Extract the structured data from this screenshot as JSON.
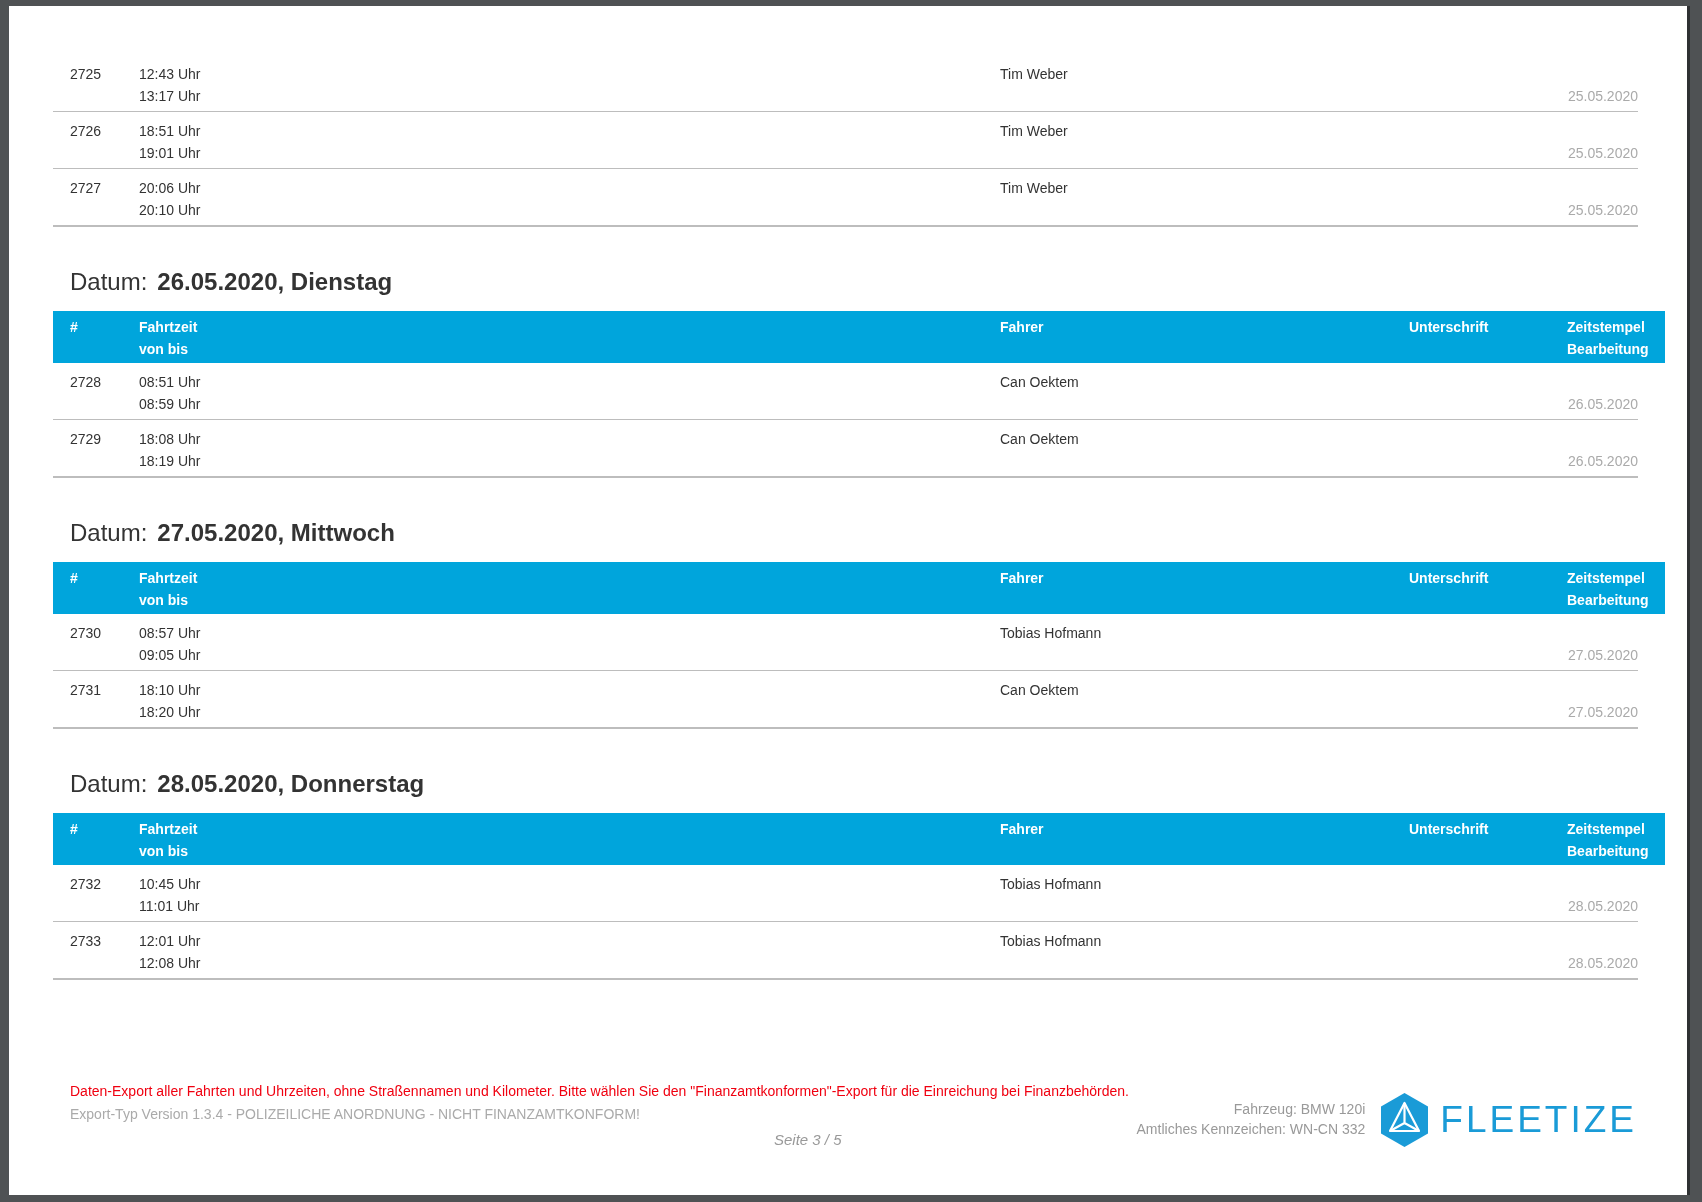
{
  "continued_table": {
    "rows": [
      {
        "number": "2725",
        "start": "12:43 Uhr",
        "end": "13:17 Uhr",
        "driver": "Tim Weber",
        "timestamp": "25.05.2020"
      },
      {
        "number": "2726",
        "start": "18:51 Uhr",
        "end": "19:01 Uhr",
        "driver": "Tim Weber",
        "timestamp": "25.05.2020"
      },
      {
        "number": "2727",
        "start": "20:06 Uhr",
        "end": "20:10 Uhr",
        "driver": "Tim Weber",
        "timestamp": "25.05.2020"
      }
    ]
  },
  "days": [
    {
      "label": "Datum:",
      "date": "26.05.2020, Dienstag",
      "columns": [
        {
          "title": "#"
        },
        {
          "title": "Fahrtzeit",
          "subtitle": "von bis"
        },
        {
          "title": "Fahrer"
        },
        {
          "title": "Unterschrift"
        },
        {
          "title": "Zeitstempel",
          "subtitle": "Bearbeitung"
        }
      ],
      "rows": [
        {
          "number": "2728",
          "start": "08:51 Uhr",
          "end": "08:59 Uhr",
          "driver": "Can Oektem",
          "timestamp": "26.05.2020"
        },
        {
          "number": "2729",
          "start": "18:08 Uhr",
          "end": "18:19 Uhr",
          "driver": "Can Oektem",
          "timestamp": "26.05.2020"
        }
      ]
    },
    {
      "label": "Datum:",
      "date": "27.05.2020, Mittwoch",
      "columns": [
        {
          "title": "#"
        },
        {
          "title": "Fahrtzeit",
          "subtitle": "von bis"
        },
        {
          "title": "Fahrer"
        },
        {
          "title": "Unterschrift"
        },
        {
          "title": "Zeitstempel",
          "subtitle": "Bearbeitung"
        }
      ],
      "rows": [
        {
          "number": "2730",
          "start": "08:57 Uhr",
          "end": "09:05 Uhr",
          "driver": "Tobias Hofmann",
          "timestamp": "27.05.2020"
        },
        {
          "number": "2731",
          "start": "18:10 Uhr",
          "end": "18:20 Uhr",
          "driver": "Can Oektem",
          "timestamp": "27.05.2020"
        }
      ]
    },
    {
      "label": "Datum:",
      "date": "28.05.2020, Donnerstag",
      "columns": [
        {
          "title": "#"
        },
        {
          "title": "Fahrtzeit",
          "subtitle": "von bis"
        },
        {
          "title": "Fahrer"
        },
        {
          "title": "Unterschrift"
        },
        {
          "title": "Zeitstempel",
          "subtitle": "Bearbeitung"
        }
      ],
      "rows": [
        {
          "number": "2732",
          "start": "10:45 Uhr",
          "end": "11:01 Uhr",
          "driver": "Tobias Hofmann",
          "timestamp": "28.05.2020"
        },
        {
          "number": "2733",
          "start": "12:01 Uhr",
          "end": "12:08 Uhr",
          "driver": "Tobias Hofmann",
          "timestamp": "28.05.2020"
        }
      ]
    }
  ],
  "footer": {
    "notice": "Daten-Export aller Fahrten und Uhrzeiten, ohne Straßennamen und Kilometer. Bitte wählen Sie den \"Finanzamtkonformen\"-Export für die Einreichung bei Finanzbehörden.",
    "version": "Export-Typ Version 1.3.4 - POLIZEILICHE ANORDNUNG - NICHT FINANZAMTKONFORM!",
    "page": "Seite 3 / 5",
    "vehicle": "Fahrzeug: BMW 120i",
    "plate": "Amtliches Kennzeichen: WN-CN 332",
    "brand": "FLEETIZE"
  }
}
